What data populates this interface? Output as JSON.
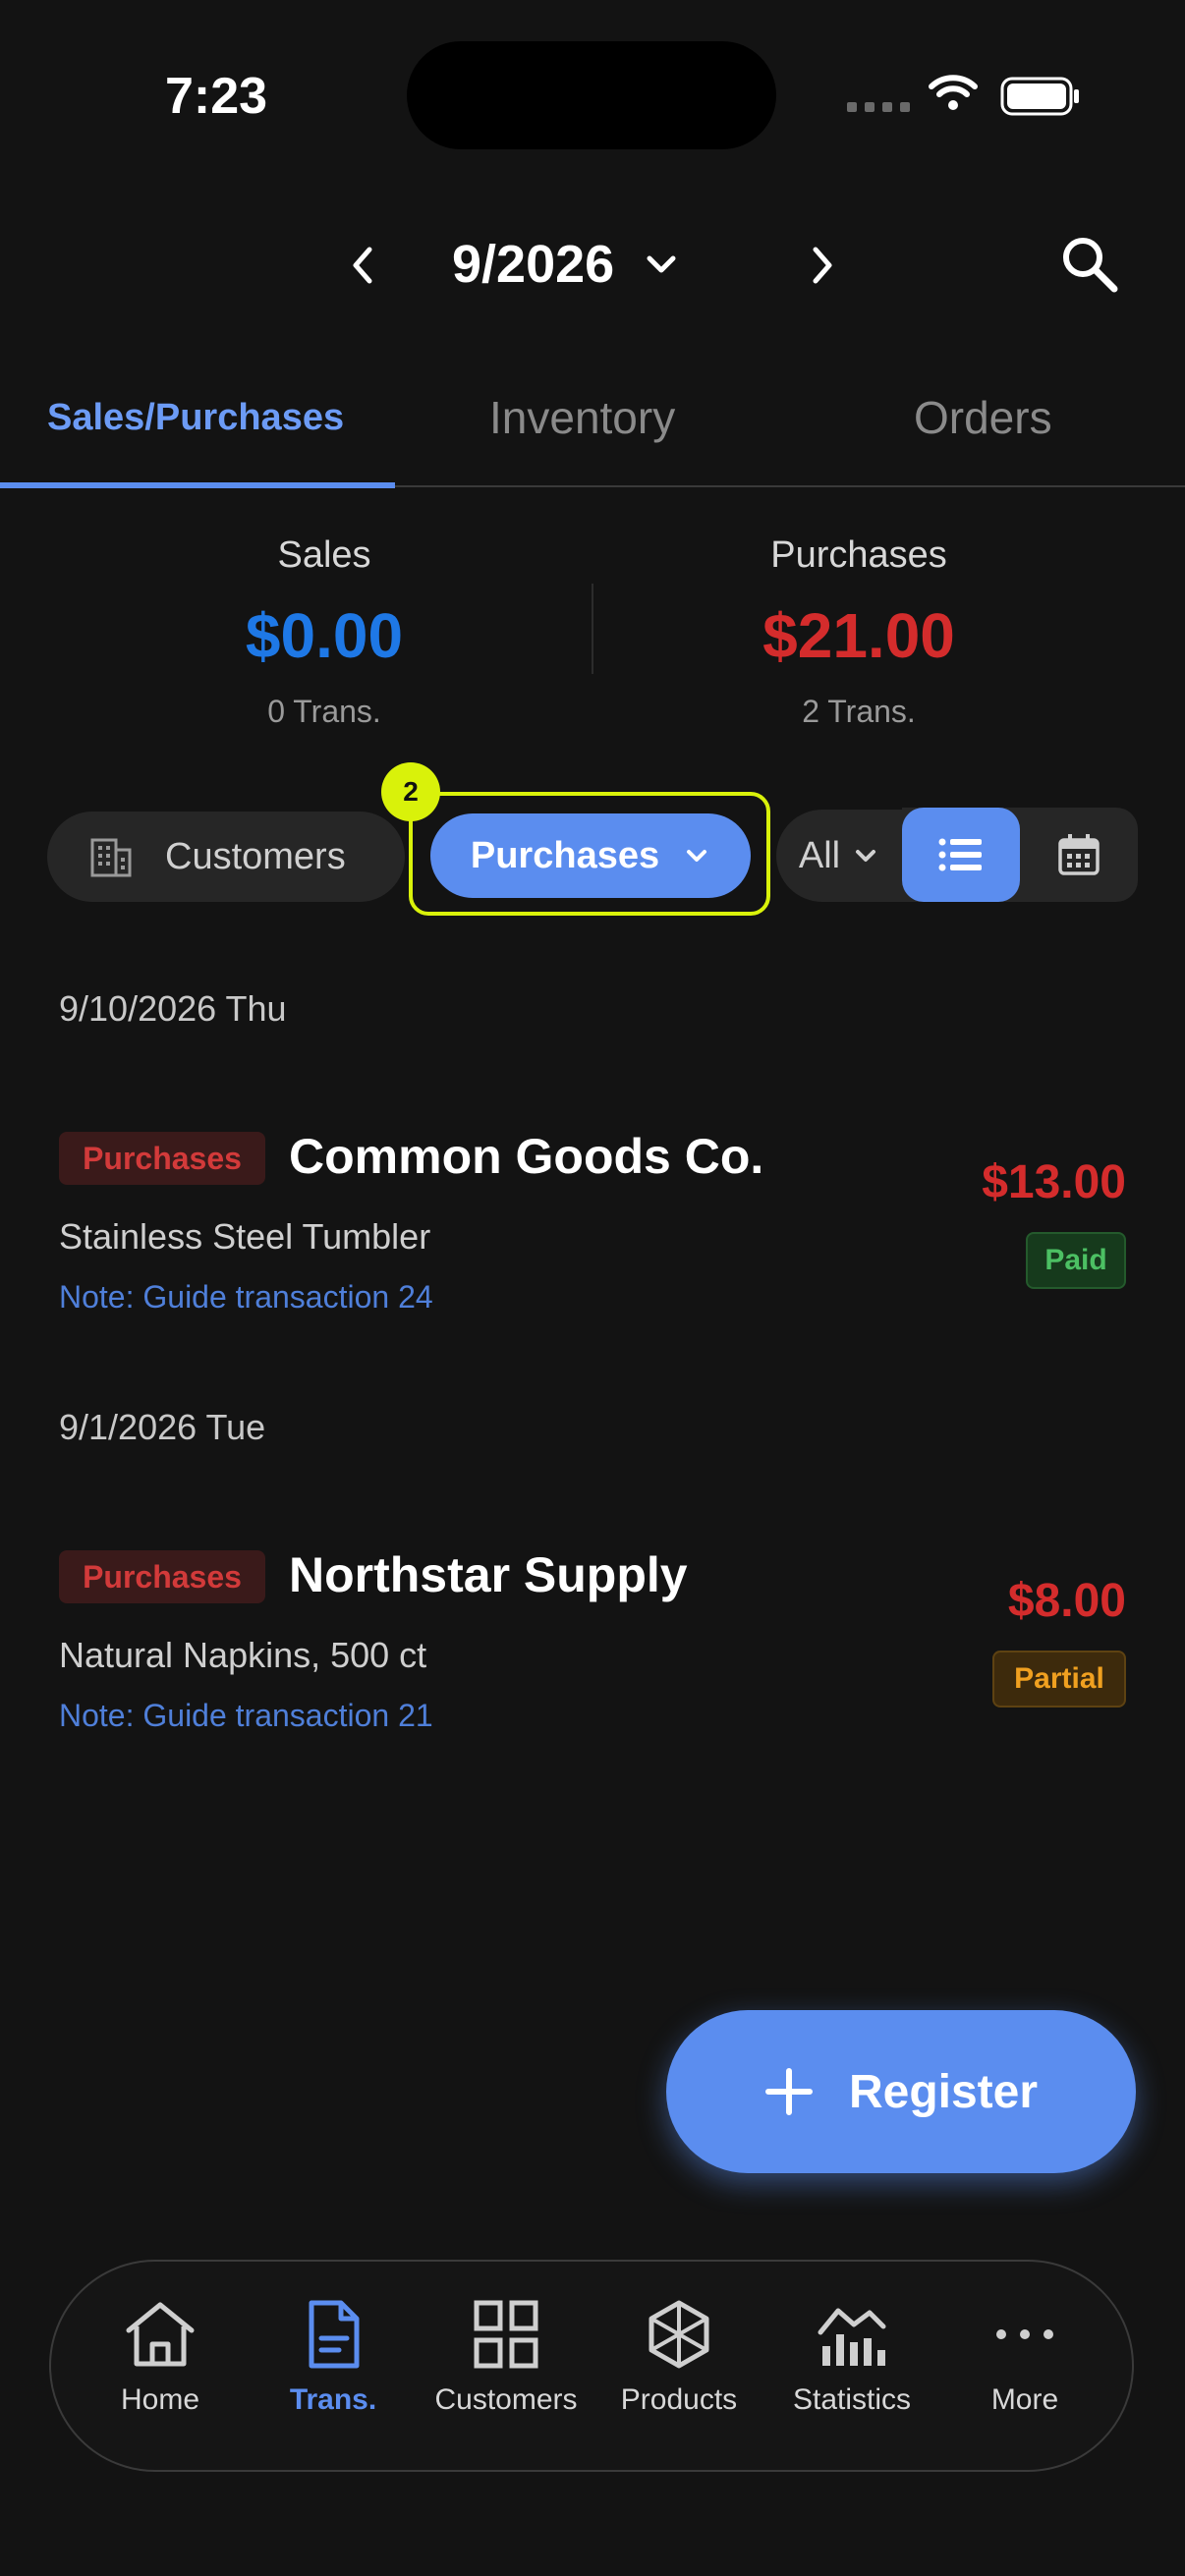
{
  "status_bar": {
    "time": "7:23"
  },
  "header": {
    "month": "9/2026"
  },
  "tabs": [
    {
      "label": "Sales/Purchases",
      "active": true
    },
    {
      "label": "Inventory"
    },
    {
      "label": "Orders"
    }
  ],
  "summary": {
    "sales": {
      "label": "Sales",
      "amount": "$0.00",
      "count": "0 Trans.",
      "color": "#1e78e6"
    },
    "purchases": {
      "label": "Purchases",
      "amount": "$21.00",
      "count": "2 Trans.",
      "color": "#d42c2c"
    }
  },
  "filters": {
    "customers_label": "Customers",
    "type_label": "Purchases",
    "focus_badge": "2",
    "status_label": "All"
  },
  "transactions": [
    {
      "date": "9/10/2026 Thu",
      "type": "Purchases",
      "name": "Common Goods Co.",
      "item": "Stainless Steel Tumbler",
      "note": "Note: Guide transaction 24",
      "amount": "$13.00",
      "status": "Paid"
    },
    {
      "date": "9/1/2026 Tue",
      "type": "Purchases",
      "name": "Northstar Supply",
      "item": "Natural Napkins, 500 ct",
      "note": "Note: Guide transaction 21",
      "amount": "$8.00",
      "status": "Partial"
    }
  ],
  "fab": {
    "label": "Register"
  },
  "nav": [
    {
      "label": "Home",
      "icon": "home-icon"
    },
    {
      "label": "Trans.",
      "icon": "document-icon",
      "active": true
    },
    {
      "label": "Customers",
      "icon": "grid-icon"
    },
    {
      "label": "Products",
      "icon": "box-icon"
    },
    {
      "label": "Statistics",
      "icon": "chart-icon"
    },
    {
      "label": "More",
      "icon": "more-icon"
    }
  ]
}
